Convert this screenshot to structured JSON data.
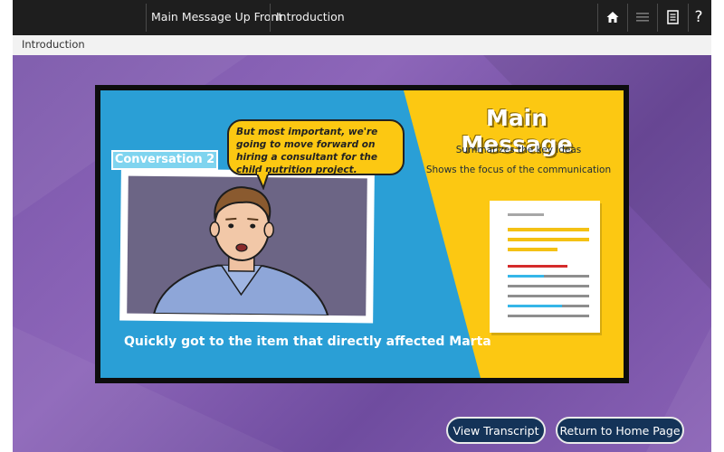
{
  "header": {
    "breadcrumb_1": "Main Message Up Front",
    "breadcrumb_2": "Introduction",
    "icons": [
      "home-icon",
      "menu-icon",
      "notes-icon",
      "help-icon"
    ],
    "help_label": "?"
  },
  "subheader": {
    "title": "Introduction"
  },
  "slide": {
    "conversation_label": "Conversation 2",
    "speech": "But most important, we're going to move forward on hiring a consultant for the child nutrition project.",
    "caption": "Quickly got to the item that directly affected Marta",
    "panel_title": "Main Message",
    "panel_lines": [
      "Summarizes the key ideas",
      "Shows the focus of the communication"
    ]
  },
  "buttons": {
    "transcript": "View Transcript",
    "home": "Return to Home Page"
  },
  "colors": {
    "topbar": "#1e1e1e",
    "stage": "#7a56aa",
    "slide_blue": "#2a9fd6",
    "slide_yellow": "#fcc812",
    "button_bg": "#143358"
  }
}
